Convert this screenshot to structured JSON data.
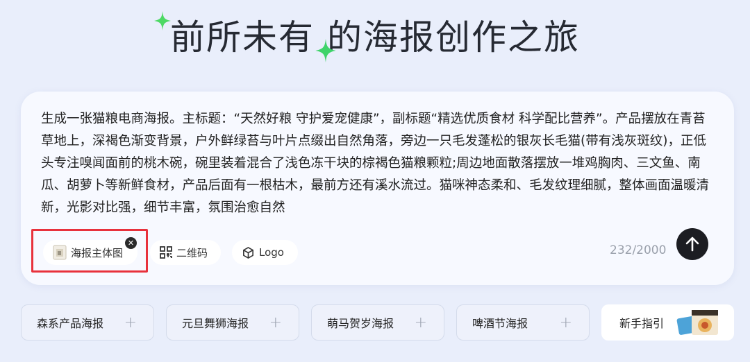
{
  "header": {
    "title": "前所未有 的海报创作之旅"
  },
  "prompt": {
    "text": "生成一张猫粮电商海报。主标题：“天然好粮 守护爱宠健康”，副标题“精选优质食材 科学配比营养”。产品摆放在青苔草地上，深褐色渐变背景，户外鲜绿苔与叶片点缀出自然角落，旁边一只毛发蓬松的银灰长毛猫(带有浅灰斑纹)，正低头专注嗅闻面前的桃木碗，碗里装着混合了浅色冻干块的棕褐色猫粮颗粒;周边地面散落摆放一堆鸡胸肉、三文鱼、南瓜、胡萝卜等新鲜食材，产品后面有一根枯木，最前方还有溪水流过。猫咪神态柔和、毛发纹理细腻，整体画面温暖清新，光影对比强，细节丰富，氛围治愈自然",
    "counter": "232/2000"
  },
  "attachments": [
    {
      "label": "海报主体图",
      "icon": "image-thumbnail-icon",
      "selected": true
    },
    {
      "label": "二维码",
      "icon": "qr-code-icon"
    },
    {
      "label": "Logo",
      "icon": "cube-icon"
    }
  ],
  "templates": [
    {
      "label": "森系产品海报"
    },
    {
      "label": "元旦舞狮海报"
    },
    {
      "label": "萌马贺岁海报"
    },
    {
      "label": "啤酒节海报"
    }
  ],
  "guide": {
    "label": "新手指引"
  },
  "colors": {
    "accent_sparkle": "#4cd964",
    "highlight": "#e8323c",
    "send_button": "#1c1d22"
  }
}
